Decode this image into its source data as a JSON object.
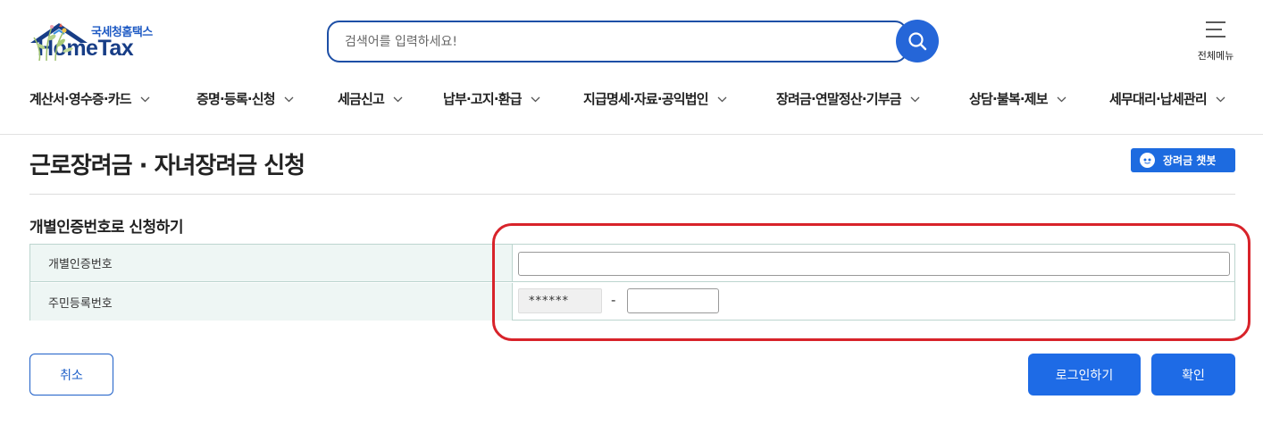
{
  "header": {
    "logo_sub": "국세청홈택스",
    "logo_main": "HomeTax",
    "search_placeholder": "검색어를 입력하세요!",
    "all_menu_label": "전체메뉴"
  },
  "gnb": [
    {
      "label": "계산서·영수증·카드"
    },
    {
      "label": "증명·등록·신청"
    },
    {
      "label": "세금신고"
    },
    {
      "label": "납부·고지·환급"
    },
    {
      "label": "지급명세·자료·공익법인"
    },
    {
      "label": "장려금·연말정산·기부금"
    },
    {
      "label": "상담·불복·제보"
    },
    {
      "label": "세무대리·납세관리"
    }
  ],
  "page": {
    "title": "근로장려금 · 자녀장려금 신청",
    "chatbot_label": "장려금 챗봇",
    "section_title": "개별인증번호로 신청하기"
  },
  "form": {
    "cert_label": "개별인증번호",
    "cert_value": "",
    "rrn_label": "주민등록번호",
    "rrn_front_masked": "******",
    "rrn_separator": "-",
    "rrn_back_value": ""
  },
  "buttons": {
    "cancel": "취소",
    "login": "로그인하기",
    "confirm": "확인"
  },
  "colors": {
    "brand_blue": "#1e6be6",
    "highlight_red": "#d8232a",
    "table_header_bg": "#eef6f4"
  }
}
